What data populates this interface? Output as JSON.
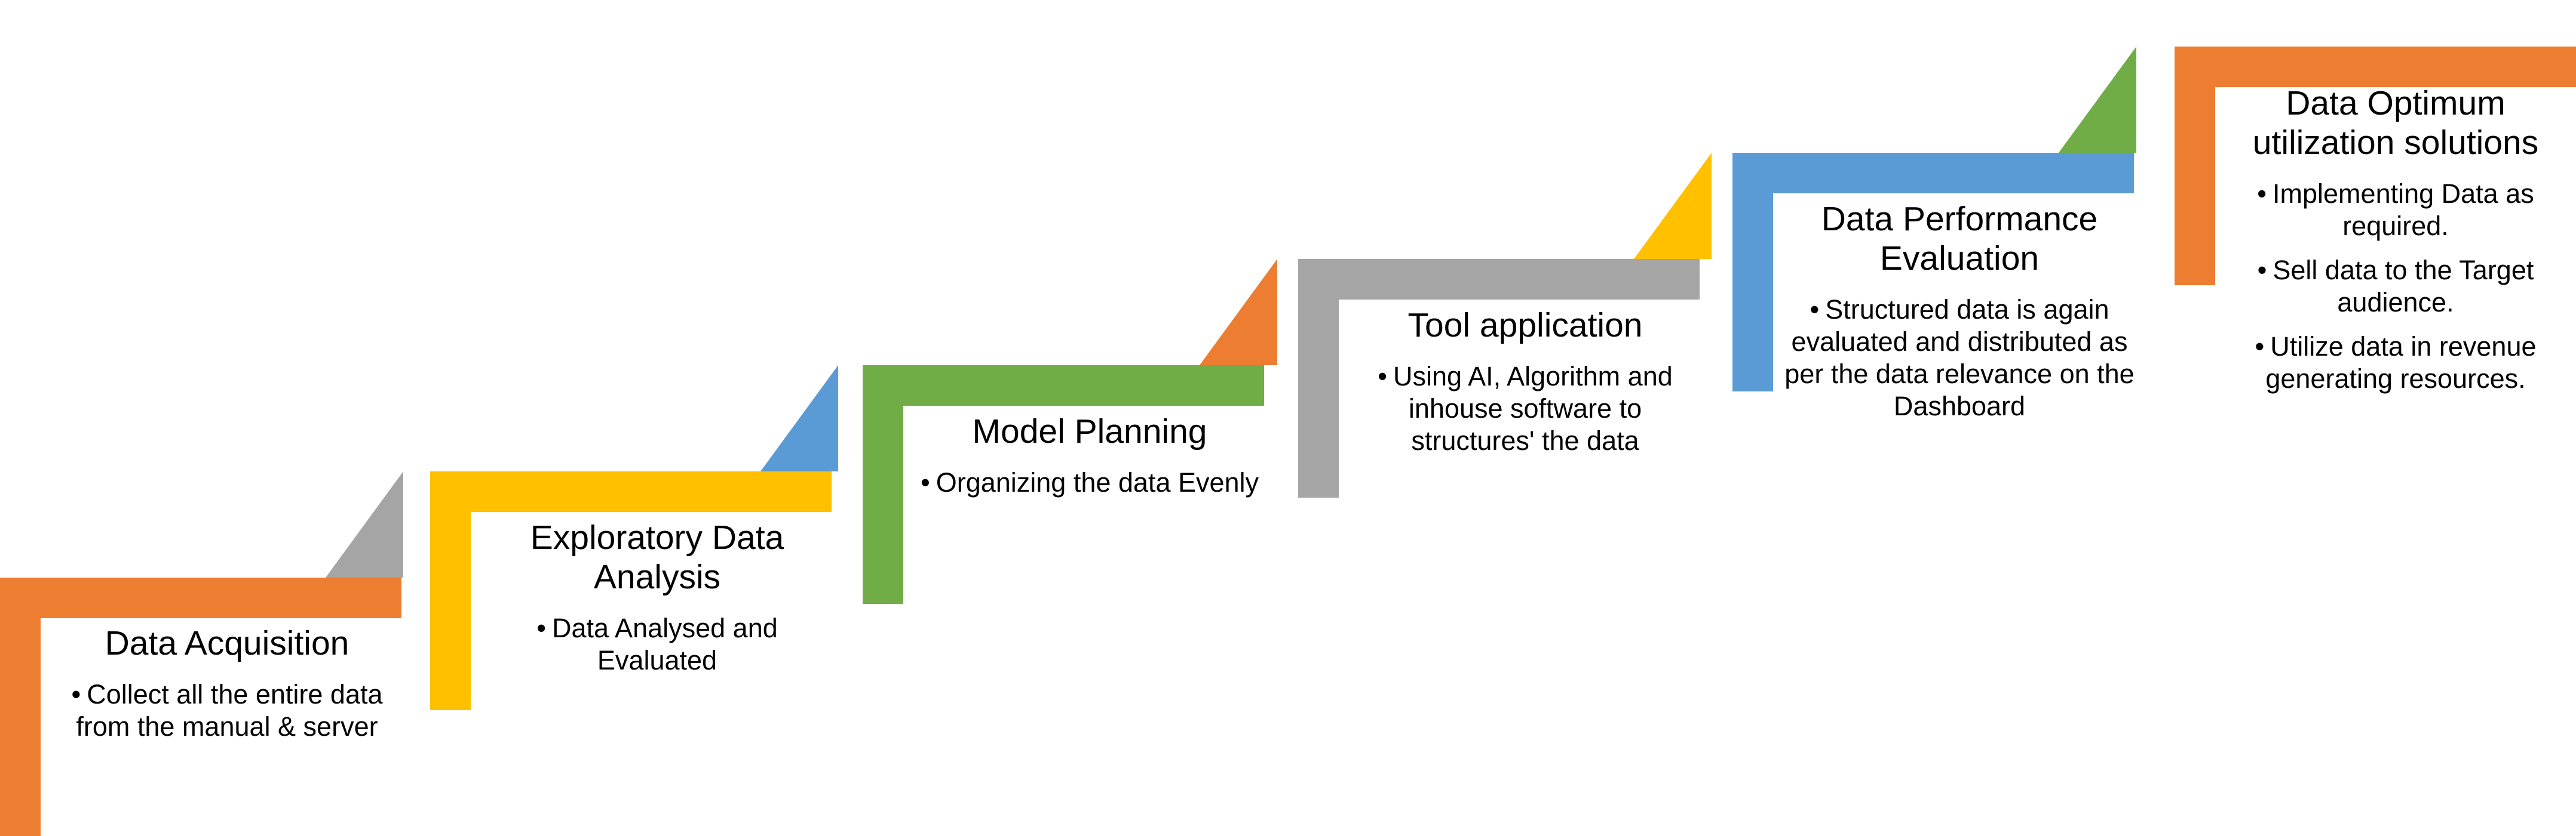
{
  "diagram": {
    "type": "staircase-process",
    "background": "#ffffff",
    "step_count": 6,
    "palette": {
      "orange": "#ED7D31",
      "yellow": "#FFC000",
      "green": "#70AD47",
      "gray": "#A5A5A5",
      "blue": "#5B9BD5"
    },
    "bullet_glyph": "•"
  },
  "steps": [
    {
      "index": 1,
      "title": "Data Acquisition",
      "bullets": [
        "Collect all the entire data from the manual & server"
      ],
      "bar_color": "#ED7D31",
      "accent_color": "#A5A5A5",
      "accent_visible": false
    },
    {
      "index": 2,
      "title": "Exploratory Data Analysis",
      "bullets": [
        "Data Analysed and Evaluated"
      ],
      "bar_color": "#FFC000",
      "accent_color": "#A5A5A5",
      "accent_visible": true
    },
    {
      "index": 3,
      "title": "Model Planning",
      "bullets": [
        "Organizing the data Evenly"
      ],
      "bar_color": "#70AD47",
      "accent_color": "#5B9BD5",
      "accent_visible": true
    },
    {
      "index": 4,
      "title": "Tool application",
      "bullets": [
        "Using AI, Algorithm and inhouse software to structures' the data"
      ],
      "bar_color": "#A5A5A5",
      "accent_color": "#ED7D31",
      "accent_visible": true
    },
    {
      "index": 5,
      "title": "Data Performance Evaluation",
      "bullets": [
        "Structured data is again evaluated and distributed as per the data relevance on the Dashboard"
      ],
      "bar_color": "#5B9BD5",
      "accent_color": "#FFC000",
      "accent_visible": true
    },
    {
      "index": 6,
      "title": "Data Optimum utilization solutions",
      "bullets": [
        "Implementing Data as required.",
        "Sell data to the Target audience.",
        "Utilize data in revenue generating resources."
      ],
      "bar_color": "#ED7D31",
      "accent_color": "#70AD47",
      "accent_visible": true
    }
  ]
}
